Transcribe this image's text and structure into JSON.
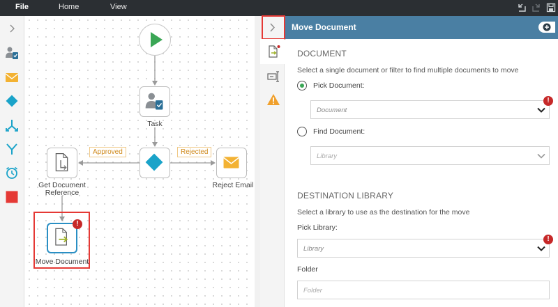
{
  "menu": {
    "file": "File",
    "home": "Home",
    "view": "View"
  },
  "toolbox": {
    "tools": [
      "task-icon",
      "email-icon",
      "decision-icon",
      "split-icon",
      "merge-icon",
      "timer-icon",
      "stop-icon"
    ]
  },
  "workflow": {
    "nodes": {
      "start": {
        "icon": "play-icon"
      },
      "task": {
        "label": "Task"
      },
      "decision": {
        "icon": "diamond-icon"
      },
      "get_doc_ref": {
        "label_line1": "Get Document",
        "label_line2": "Reference"
      },
      "reject_email": {
        "label": "Reject Email"
      },
      "move_doc": {
        "label": "Move Document",
        "error": "!"
      }
    },
    "conditions": {
      "approved": "Approved",
      "rejected": "Rejected"
    }
  },
  "panel": {
    "title": "Move Document",
    "document_section": {
      "title": "DOCUMENT",
      "description": "Select a single document or filter to find multiple documents to move",
      "pick_label": "Pick Document:",
      "pick_placeholder": "Document",
      "find_label": "Find Document:",
      "find_placeholder": "Library",
      "selected": "pick"
    },
    "destination_section": {
      "title": "DESTINATION LIBRARY",
      "description": "Select a library to use as the destination for the move",
      "pick_library_label": "Pick Library:",
      "library_placeholder": "Library",
      "folder_label": "Folder",
      "folder_placeholder": "Folder"
    },
    "error_glyph": "!"
  },
  "colors": {
    "topbar": "#2b2f33",
    "panel_header": "#4a7fa3",
    "start_green": "#3aa655",
    "teal": "#1aa3c9",
    "email_orange": "#f3b233",
    "error_red": "#c62828",
    "highlight": "#e53935"
  }
}
